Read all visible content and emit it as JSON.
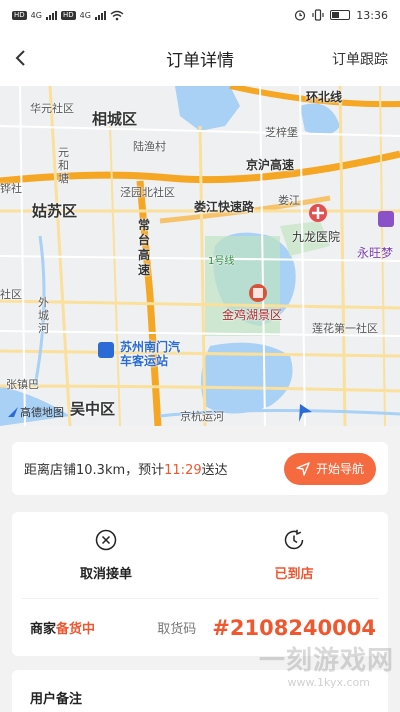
{
  "status_bar": {
    "hd1": "HD",
    "hd2": "HD",
    "net1": "4G",
    "net2": "4G",
    "time": "13:36"
  },
  "header": {
    "title": "订单详情",
    "track": "订单跟踪"
  },
  "map": {
    "labels": {
      "huayuan": "华元社区",
      "xiangcheng": "相城区",
      "huanbei": "环北线",
      "zhiyuan": "芝梓堡",
      "luyu": "陆渔村",
      "yuanhetang": "元和塘",
      "jinghu": "京沪高速",
      "jingzhong": "泾园北社区",
      "gusu": "姑苏区",
      "loujiang": "娄江快速路",
      "loujiang2": "娄江",
      "jiulong": "九龙医院",
      "yongwang": "永旺梦",
      "changtai": "常台高速",
      "line1": "1号线",
      "jinji": "金鸡湖景区",
      "waicheng": "外城河",
      "nanmen": "苏州南门汽车客运站",
      "lianhua": "莲花第一社区",
      "zhangzhen": "张镇巴",
      "wuzhong": "吴中区",
      "jinghang": "京杭运河",
      "gaode": "高德地图",
      "she": "社区",
      "hua": "铧社"
    }
  },
  "nav_card": {
    "distance_text": "距离店铺10.3km，预计",
    "eta": "11:29",
    "suffix": "送达",
    "button": "开始导航"
  },
  "actions": {
    "cancel": "取消接单",
    "arrived": "已到店"
  },
  "pickup": {
    "merchant": "商家",
    "status": "备货中",
    "code_label": "取货码",
    "code": "#2108240004"
  },
  "remark": {
    "title": "用户备注"
  },
  "watermark": {
    "main": "一刻游戏网",
    "url": "www.1kyx.com"
  },
  "colors": {
    "accent": "#f0572f",
    "button": "#f56b3f"
  }
}
